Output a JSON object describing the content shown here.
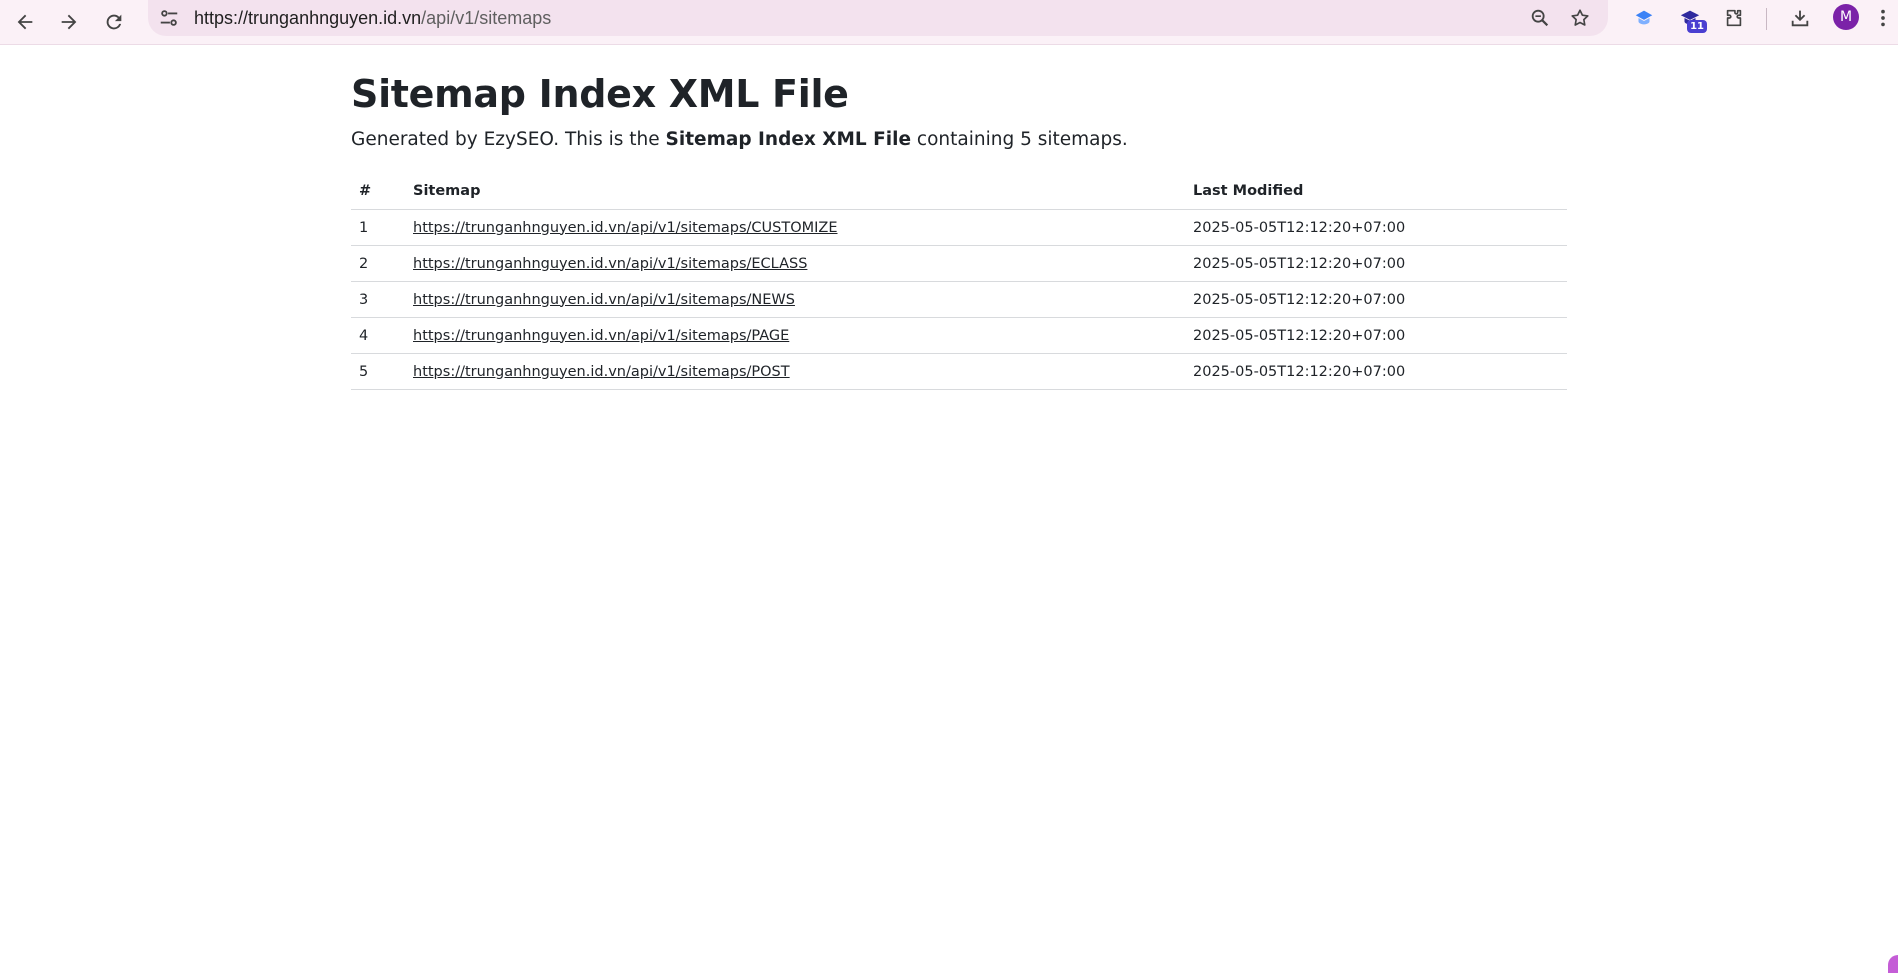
{
  "browser": {
    "url_host": "https://trunganhnguyen.id.vn",
    "url_path": "/api/v1/sitemaps",
    "extension_badge": "11",
    "avatar_letter": "M",
    "icons": [
      "back-icon",
      "forward-icon",
      "reload-icon",
      "site-info-icon",
      "zoom-icon",
      "bookmark-star-icon",
      "extension-graduation-icon",
      "extension-cap-badge-icon",
      "extensions-puzzle-icon",
      "download-icon",
      "menu-dots-icon"
    ],
    "colors": {
      "toolbar": "#fbf1f7",
      "omnibox": "#f3e2ee",
      "avatar": "#7b22a8",
      "badge": "#4a3fd1"
    }
  },
  "page": {
    "title": "Sitemap Index XML File",
    "intro_prefix": "Generated by EzySEO. This is the ",
    "intro_bold": "Sitemap Index XML File",
    "intro_suffix": " containing 5 sitemaps.",
    "table": {
      "headers": [
        "#",
        "Sitemap",
        "Last Modified"
      ],
      "rows": [
        {
          "num": "1",
          "url": "https://trunganhnguyen.id.vn/api/v1/sitemaps/CUSTOMIZE",
          "modified": "2025-05-05T12:12:20+07:00"
        },
        {
          "num": "2",
          "url": "https://trunganhnguyen.id.vn/api/v1/sitemaps/ECLASS",
          "modified": "2025-05-05T12:12:20+07:00"
        },
        {
          "num": "3",
          "url": "https://trunganhnguyen.id.vn/api/v1/sitemaps/NEWS",
          "modified": "2025-05-05T12:12:20+07:00"
        },
        {
          "num": "4",
          "url": "https://trunganhnguyen.id.vn/api/v1/sitemaps/PAGE",
          "modified": "2025-05-05T12:12:20+07:00"
        },
        {
          "num": "5",
          "url": "https://trunganhnguyen.id.vn/api/v1/sitemaps/POST",
          "modified": "2025-05-05T12:12:20+07:00"
        }
      ]
    }
  }
}
